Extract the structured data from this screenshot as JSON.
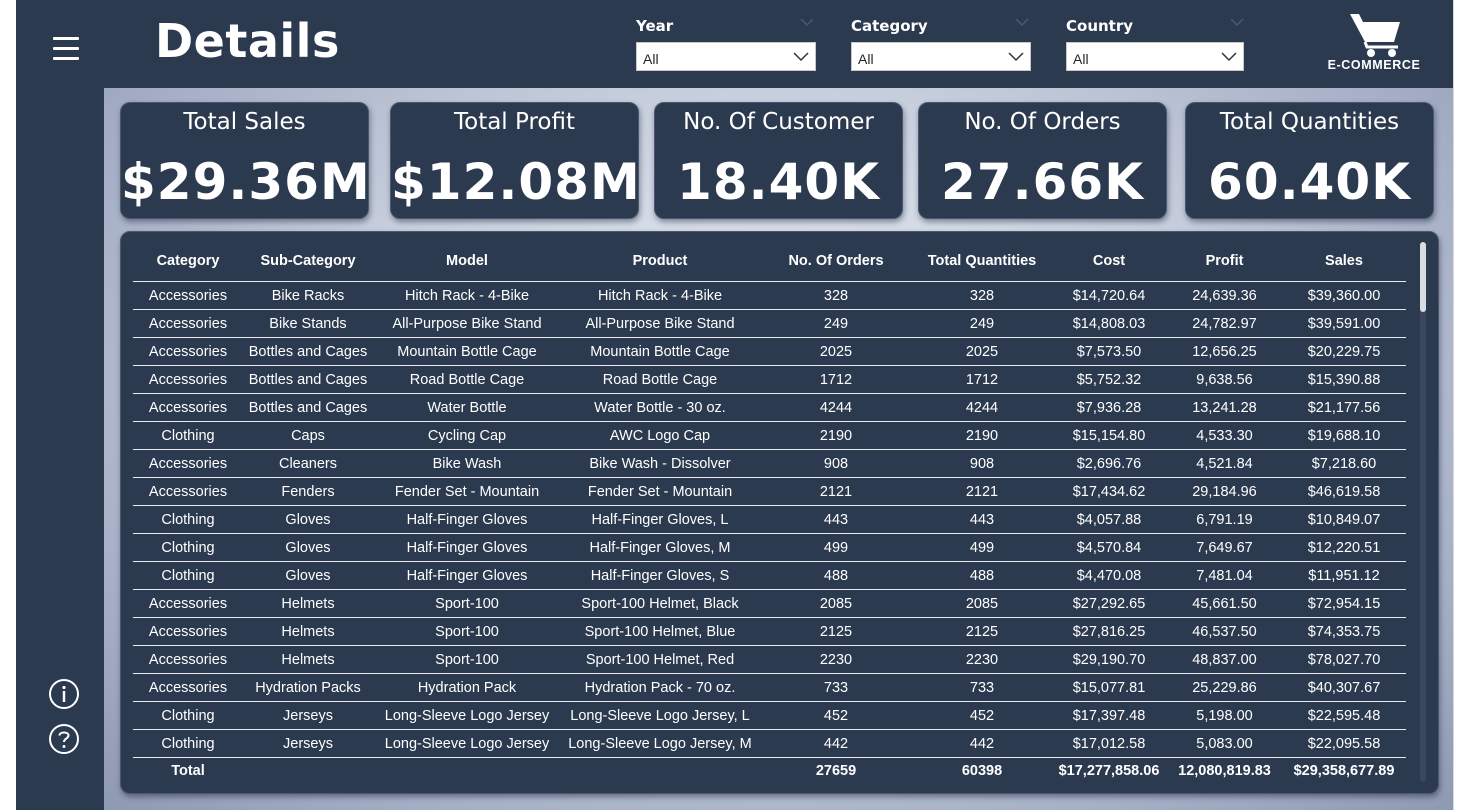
{
  "header": {
    "title": "Details",
    "brand_label": "E-COMMERCE"
  },
  "slicers": [
    {
      "label": "Year",
      "value": "All"
    },
    {
      "label": "Category",
      "value": "All"
    },
    {
      "label": "Country",
      "value": "All"
    }
  ],
  "kpis": [
    {
      "title": "Total Sales",
      "value": "$29.36M"
    },
    {
      "title": "Total Profit",
      "value": "$12.08M"
    },
    {
      "title": "No. Of Customer",
      "value": "18.40K"
    },
    {
      "title": "No. Of Orders",
      "value": "27.66K"
    },
    {
      "title": "Total Quantities",
      "value": "60.40K"
    }
  ],
  "table": {
    "headers": [
      "Category",
      "Sub-Category",
      "Model",
      "Product",
      "No. Of Orders",
      "Total Quantities",
      "Cost",
      "Profit",
      "Sales"
    ],
    "rows": [
      [
        "Accessories",
        "Bike Racks",
        "Hitch Rack - 4-Bike",
        "Hitch Rack - 4-Bike",
        "328",
        "328",
        "$14,720.64",
        "24,639.36",
        "$39,360.00"
      ],
      [
        "Accessories",
        "Bike Stands",
        "All-Purpose Bike Stand",
        "All-Purpose Bike Stand",
        "249",
        "249",
        "$14,808.03",
        "24,782.97",
        "$39,591.00"
      ],
      [
        "Accessories",
        "Bottles and Cages",
        "Mountain Bottle Cage",
        "Mountain Bottle Cage",
        "2025",
        "2025",
        "$7,573.50",
        "12,656.25",
        "$20,229.75"
      ],
      [
        "Accessories",
        "Bottles and Cages",
        "Road Bottle Cage",
        "Road Bottle Cage",
        "1712",
        "1712",
        "$5,752.32",
        "9,638.56",
        "$15,390.88"
      ],
      [
        "Accessories",
        "Bottles and Cages",
        "Water Bottle",
        "Water Bottle - 30 oz.",
        "4244",
        "4244",
        "$7,936.28",
        "13,241.28",
        "$21,177.56"
      ],
      [
        "Clothing",
        "Caps",
        "Cycling Cap",
        "AWC Logo Cap",
        "2190",
        "2190",
        "$15,154.80",
        "4,533.30",
        "$19,688.10"
      ],
      [
        "Accessories",
        "Cleaners",
        "Bike Wash",
        "Bike Wash - Dissolver",
        "908",
        "908",
        "$2,696.76",
        "4,521.84",
        "$7,218.60"
      ],
      [
        "Accessories",
        "Fenders",
        "Fender Set - Mountain",
        "Fender Set - Mountain",
        "2121",
        "2121",
        "$17,434.62",
        "29,184.96",
        "$46,619.58"
      ],
      [
        "Clothing",
        "Gloves",
        "Half-Finger Gloves",
        "Half-Finger Gloves, L",
        "443",
        "443",
        "$4,057.88",
        "6,791.19",
        "$10,849.07"
      ],
      [
        "Clothing",
        "Gloves",
        "Half-Finger Gloves",
        "Half-Finger Gloves, M",
        "499",
        "499",
        "$4,570.84",
        "7,649.67",
        "$12,220.51"
      ],
      [
        "Clothing",
        "Gloves",
        "Half-Finger Gloves",
        "Half-Finger Gloves, S",
        "488",
        "488",
        "$4,470.08",
        "7,481.04",
        "$11,951.12"
      ],
      [
        "Accessories",
        "Helmets",
        "Sport-100",
        "Sport-100 Helmet, Black",
        "2085",
        "2085",
        "$27,292.65",
        "45,661.50",
        "$72,954.15"
      ],
      [
        "Accessories",
        "Helmets",
        "Sport-100",
        "Sport-100 Helmet, Blue",
        "2125",
        "2125",
        "$27,816.25",
        "46,537.50",
        "$74,353.75"
      ],
      [
        "Accessories",
        "Helmets",
        "Sport-100",
        "Sport-100 Helmet, Red",
        "2230",
        "2230",
        "$29,190.70",
        "48,837.00",
        "$78,027.70"
      ],
      [
        "Accessories",
        "Hydration Packs",
        "Hydration Pack",
        "Hydration Pack - 70 oz.",
        "733",
        "733",
        "$15,077.81",
        "25,229.86",
        "$40,307.67"
      ],
      [
        "Clothing",
        "Jerseys",
        "Long-Sleeve Logo Jersey",
        "Long-Sleeve Logo Jersey, L",
        "452",
        "452",
        "$17,397.48",
        "5,198.00",
        "$22,595.48"
      ],
      [
        "Clothing",
        "Jerseys",
        "Long-Sleeve Logo Jersey",
        "Long-Sleeve Logo Jersey, M",
        "442",
        "442",
        "$17,012.58",
        "5,083.00",
        "$22,095.58"
      ]
    ],
    "total": [
      "Total",
      "",
      "",
      "",
      "27659",
      "60398",
      "$17,277,858.06",
      "12,080,819.83",
      "$29,358,677.89"
    ]
  },
  "icons": {
    "menu": "hamburger-menu-icon",
    "cart": "shopping-cart-icon",
    "info": "info-icon",
    "help": "help-icon"
  }
}
